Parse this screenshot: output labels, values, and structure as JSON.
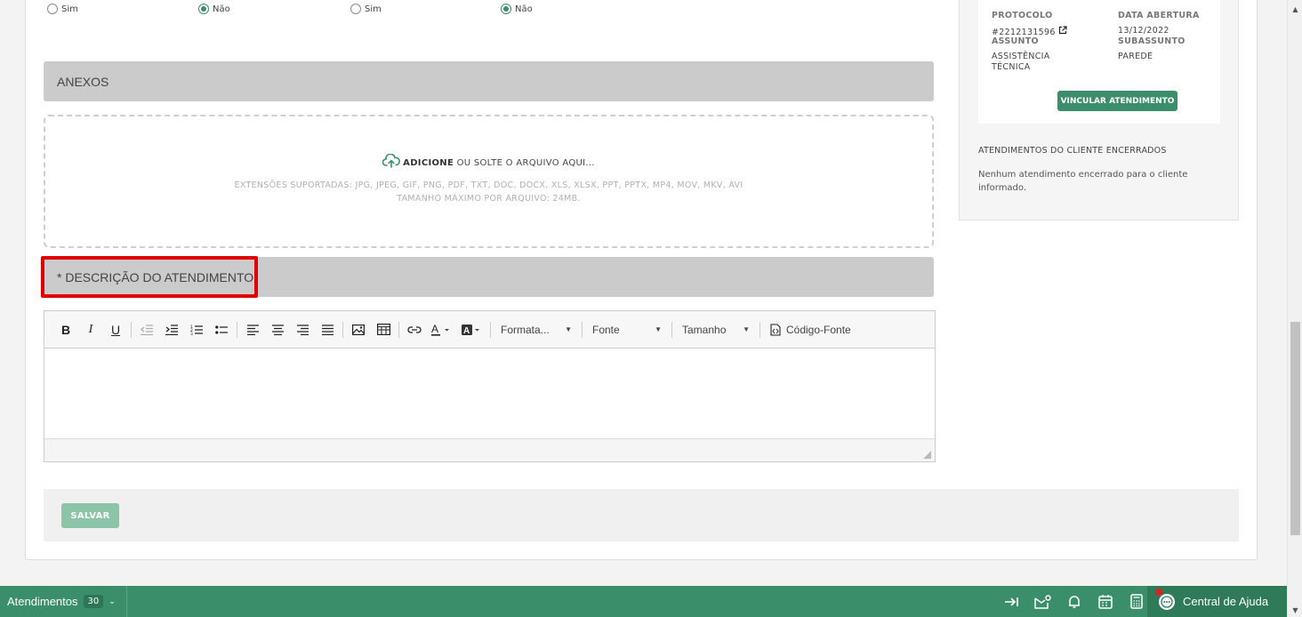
{
  "radios": [
    {
      "label": "Sim",
      "checked": false
    },
    {
      "label": "Não",
      "checked": true
    },
    {
      "label": "Sim",
      "checked": false
    },
    {
      "label": "Não",
      "checked": true
    }
  ],
  "anexos": {
    "title": "ANEXOS",
    "add_bold": "ADICIONE",
    "add_rest": "OU SOLTE O ARQUIVO AQUI...",
    "extensions": "EXTENSÕES SUPORTADAS: JPG, JPEG, GIF, PNG, PDF, TXT, DOC, DOCX, XLS, XLSX, PPT, PPTX, MP4, MOV, MKV, AVI",
    "max_size": "TAMANHO MÁXIMO POR ARQUIVO: 24MB."
  },
  "descricao": {
    "title": "* DESCRIÇÃO DO ATENDIMENTO"
  },
  "editor": {
    "bold": "B",
    "italic": "I",
    "underline": "U",
    "format_label": "Formata...",
    "font_label": "Fonte",
    "size_label": "Tamanho",
    "source_label": "Código-Fonte"
  },
  "footer": {
    "save_label": "SALVAR"
  },
  "side": {
    "protocolo_label": "PROTOCOLO",
    "protocolo_value": "#2212131596",
    "data_label": "DATA ABERTURA",
    "data_value": "13/12/2022",
    "assunto_label": "ASSUNTO",
    "assunto_value_1": "ASSISTÊNCIA",
    "assunto_value_2": "TÉCNICA",
    "subassunto_label": "SUBASSUNTO",
    "subassunto_value": "PAREDE",
    "vincular_label": "VINCULAR ATENDIMENTO",
    "encerrados_heading": "ATENDIMENTOS DO CLIENTE ENCERRADOS",
    "encerrados_text": "Nenhum atendimento encerrado para o cliente informado."
  },
  "bottom_bar": {
    "title": "Atendimentos",
    "count": "30",
    "help_label": "Central de Ajuda"
  },
  "colors": {
    "accent": "#3a8f6a",
    "highlight": "#e00000",
    "save_disabled": "#8cc4a8"
  },
  "icons": [
    "cloud-upload-icon",
    "external-link-icon",
    "collapse-icon",
    "mail-settings-icon",
    "bell-icon",
    "calendar-icon",
    "calculator-icon",
    "chat-icon"
  ]
}
